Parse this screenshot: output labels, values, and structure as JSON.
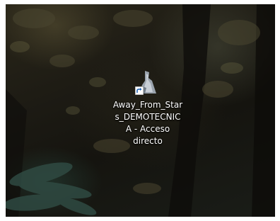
{
  "desktop": {
    "shortcut": {
      "label_lines": [
        "Away_From_Star",
        "s_DEMOTECNIC",
        "A - Acceso",
        "directo"
      ],
      "icon": "app-shortcut-icon",
      "overlay_icon": "shortcut-arrow-icon"
    }
  }
}
